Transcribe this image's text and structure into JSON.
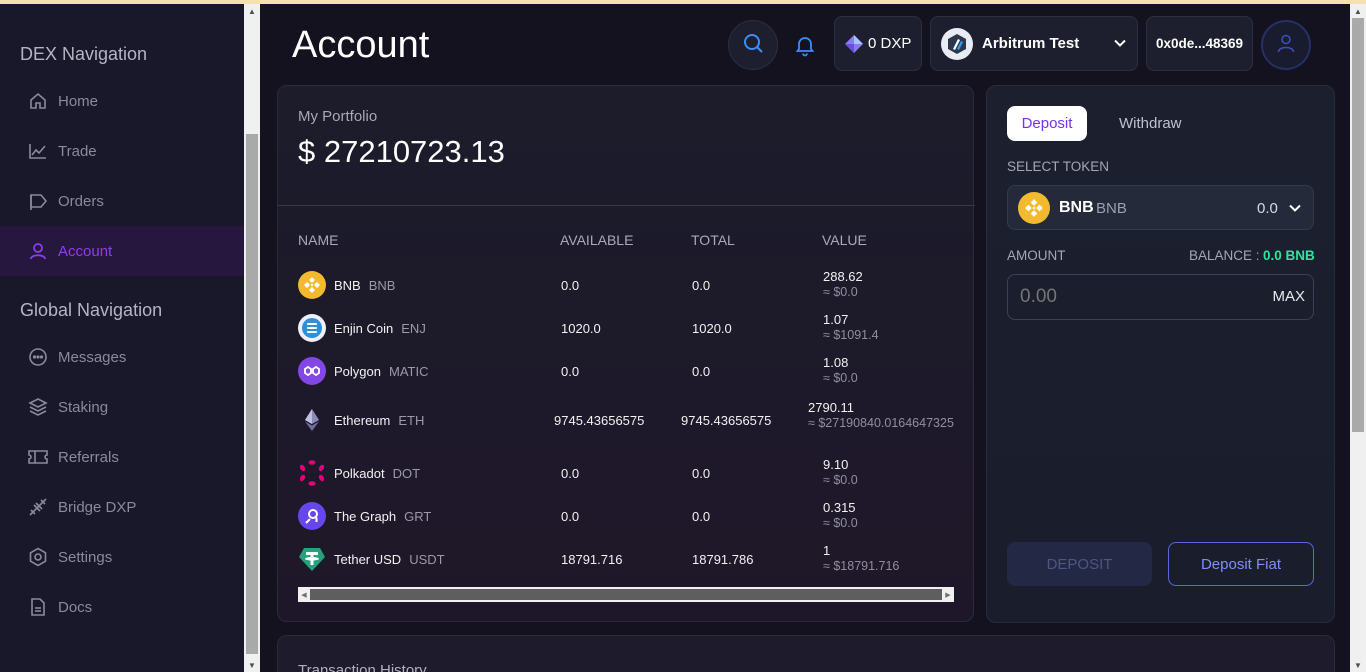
{
  "sidebar": {
    "dex_heading": "DEX Navigation",
    "global_heading": "Global Navigation",
    "dex_items": [
      {
        "label": "Home",
        "icon": "home-icon"
      },
      {
        "label": "Trade",
        "icon": "chart-line-icon"
      },
      {
        "label": "Orders",
        "icon": "orders-icon"
      },
      {
        "label": "Account",
        "icon": "user-icon"
      }
    ],
    "global_items": [
      {
        "label": "Messages",
        "icon": "chat-icon"
      },
      {
        "label": "Staking",
        "icon": "layers-icon"
      },
      {
        "label": "Referrals",
        "icon": "ticket-icon"
      },
      {
        "label": "Bridge DXP",
        "icon": "bridge-icon"
      },
      {
        "label": "Settings",
        "icon": "settings-icon"
      },
      {
        "label": "Docs",
        "icon": "document-icon"
      }
    ],
    "active_item": "Account"
  },
  "header": {
    "title": "Account",
    "dxp_balance": "0 DXP",
    "network": "Arbitrum Test",
    "wallet_address": "0x0de...48369"
  },
  "portfolio": {
    "label": "My Portfolio",
    "value": "$ 27210723.13",
    "columns": [
      "NAME",
      "AVAILABLE",
      "TOTAL",
      "VALUE"
    ],
    "rows": [
      {
        "name": "BNB",
        "symbol": "BNB",
        "available": "0.0",
        "total": "0.0",
        "price": "288.62",
        "usd": "≈ $0.0",
        "logo": "bnb-logo",
        "color": "#f3ba2f"
      },
      {
        "name": "Enjin Coin",
        "symbol": "ENJ",
        "available": "1020.0",
        "total": "1020.0",
        "price": "1.07",
        "usd": "≈ $1091.4",
        "logo": "enjin-logo",
        "color": "#7866d5"
      },
      {
        "name": "Polygon",
        "symbol": "MATIC",
        "available": "0.0",
        "total": "0.0",
        "price": "1.08",
        "usd": "≈ $0.0",
        "logo": "polygon-logo",
        "color": "#8247e5"
      },
      {
        "name": "Ethereum",
        "symbol": "ETH",
        "available": "9745.43656575",
        "total": "9745.43656575",
        "price": "2790.11",
        "usd": "≈ $27190840.0164647325",
        "logo": "ethereum-logo",
        "color": "#8c8cb8"
      },
      {
        "name": "Polkadot",
        "symbol": "DOT",
        "available": "0.0",
        "total": "0.0",
        "price": "9.10",
        "usd": "≈ $0.0",
        "logo": "polkadot-logo",
        "color": "#e6007a"
      },
      {
        "name": "The Graph",
        "symbol": "GRT",
        "available": "0.0",
        "total": "0.0",
        "price": "0.315",
        "usd": "≈ $0.0",
        "logo": "the-graph-logo",
        "color": "#6747ed"
      },
      {
        "name": "Tether USD",
        "symbol": "USDT",
        "available": "18791.716",
        "total": "18791.786",
        "price": "1",
        "usd": "≈ $18791.716",
        "logo": "tether-logo",
        "color": "#26a17b"
      }
    ]
  },
  "deposit_panel": {
    "tab_deposit": "Deposit",
    "tab_withdraw": "Withdraw",
    "select_token_label": "SELECT TOKEN",
    "token_name": "BNB",
    "token_symbol": "BNB",
    "token_balance": "0.0",
    "amount_label": "AMOUNT",
    "balance_label": "BALANCE :",
    "balance_value": "0.0 BNB",
    "amount_placeholder": "0.00",
    "max_label": "MAX",
    "deposit_button": "DEPOSIT",
    "deposit_fiat_button": "Deposit Fiat"
  },
  "transaction_history": {
    "title": "Transaction History"
  },
  "colors": {
    "accent_purple": "#8f3cf0",
    "balance_green": "#2ee59d",
    "link_blue": "#7f8dff"
  }
}
